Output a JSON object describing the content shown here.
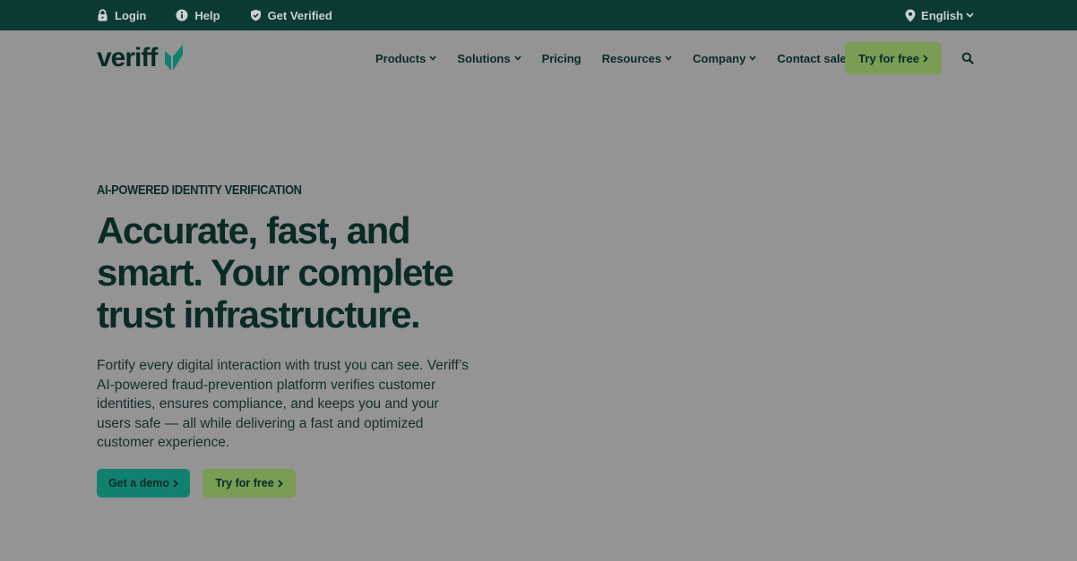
{
  "topbar": {
    "links": [
      {
        "label": "Login",
        "icon": "lock-icon"
      },
      {
        "label": "Help",
        "icon": "info-icon"
      },
      {
        "label": "Get Verified",
        "icon": "shield-check-icon"
      }
    ],
    "language": {
      "label": "English",
      "icon": "location-pin-icon"
    },
    "background": "#0b3a35"
  },
  "nav": {
    "logo_text": "veriff",
    "items": [
      {
        "label": "Products",
        "dropdown": true
      },
      {
        "label": "Solutions",
        "dropdown": true
      },
      {
        "label": "Pricing",
        "dropdown": false
      },
      {
        "label": "Resources",
        "dropdown": true
      },
      {
        "label": "Company",
        "dropdown": true
      },
      {
        "label": "Contact sales",
        "dropdown": false
      }
    ],
    "cta_label": "Try for free",
    "search_icon": "search-icon"
  },
  "hero": {
    "eyebrow": "AI-POWERED IDENTITY VERIFICATION",
    "headline": "Accurate, fast, and smart. Your complete trust infrastructure.",
    "lead": "Fortify every digital interaction with trust you can see. Veriff’s AI-powered fraud-prevention platform verifies customer identities, ensures compliance, and keeps you and your users safe — all while delivering a fast and optimized customer experience.",
    "primary_button": "Get a demo",
    "secondary_button": "Try for free"
  },
  "colors": {
    "page_overlay": "#949494",
    "brand_dark": "#0a2a26",
    "brand_teal": "#12806f",
    "brand_green": "#7a9c55"
  }
}
